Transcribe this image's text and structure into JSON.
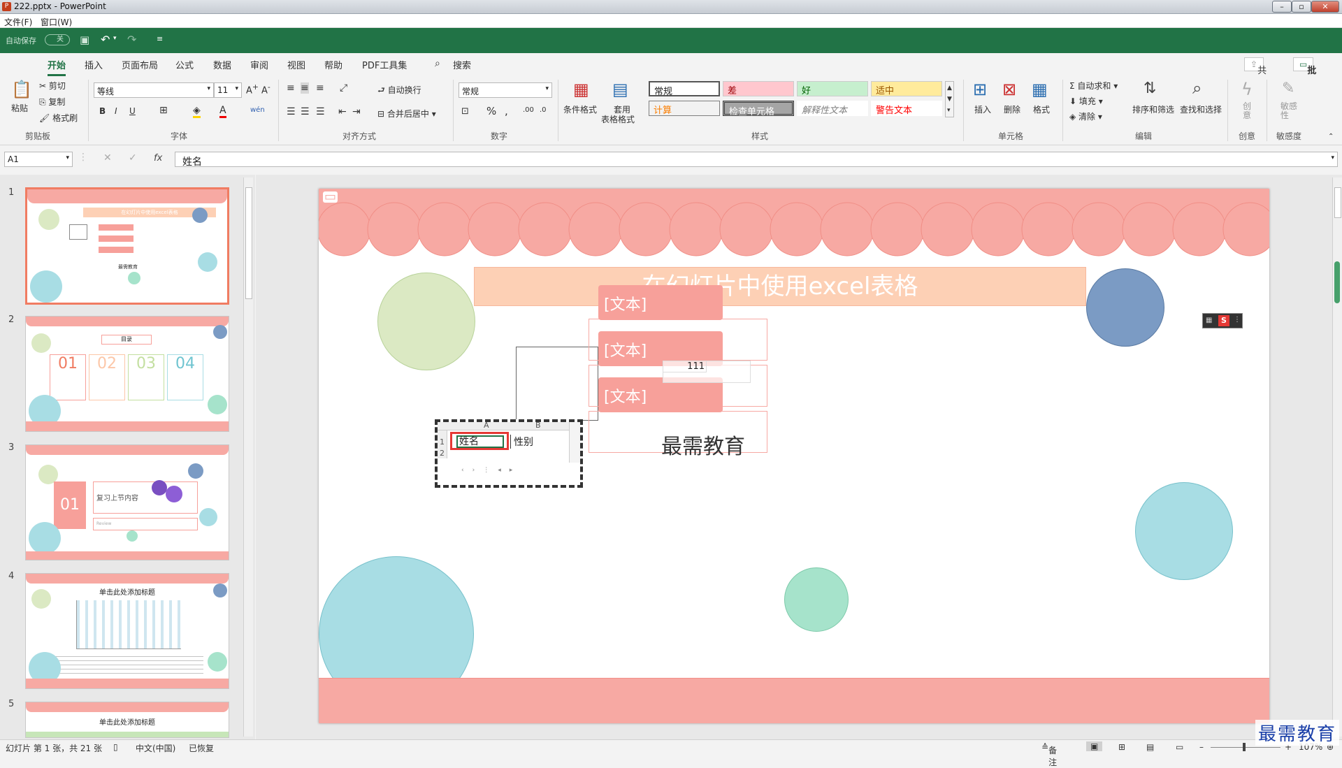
{
  "window": {
    "title": "222.pptx - PowerPoint"
  },
  "menu": {
    "file": "文件(F)",
    "window": "窗口(W)"
  },
  "qat": {
    "autosave": "自动保存",
    "toggle": "关"
  },
  "tabs": [
    "开始",
    "插入",
    "页面布局",
    "公式",
    "数据",
    "审阅",
    "视图",
    "帮助",
    "PDF工具集"
  ],
  "search": "搜索",
  "share": "共享",
  "comment": "批注",
  "ribbon": {
    "paste": "粘贴",
    "cut": "剪切",
    "copy": "复制",
    "format_painter": "格式刷",
    "clipboard": "剪贴板",
    "font_name": "等线",
    "font_size": "11",
    "font_group": "字体",
    "wrap": "自动换行",
    "merge": "合并后居中",
    "align_group": "对齐方式",
    "number_format": "常规",
    "number_group": "数字",
    "cond_format": "条件格式",
    "table_format_1": "套用",
    "table_format_2": "表格格式",
    "styles": {
      "normal": "常规",
      "bad": "差",
      "good": "好",
      "neutral": "适中",
      "calc": "计算",
      "check": "检查单元格",
      "explain": "解释性文本",
      "warn": "警告文本"
    },
    "styles_group": "样式",
    "insert": "插入",
    "delete": "删除",
    "format": "格式",
    "cells_group": "单元格",
    "autosum": "自动求和",
    "fill": "填充",
    "clear": "清除",
    "sort": "排序和筛选",
    "find": "查找和选择",
    "edit_group": "编辑",
    "create": "创意",
    "create_group": "创意",
    "sensitivity": "敏感性",
    "sensitivity_group": "敏感度"
  },
  "formula": {
    "namebox": "A1",
    "fx": "fx",
    "value": "姓名"
  },
  "thumbnails": [
    {
      "num": "1",
      "title": "在幻灯片中使用excel表格",
      "footer": "最需教育"
    },
    {
      "num": "2",
      "title": "目录",
      "items": [
        "01",
        "02",
        "03",
        "04"
      ]
    },
    {
      "num": "3",
      "badge": "01",
      "title": "复习上节内容",
      "sub": "Review"
    },
    {
      "num": "4",
      "title": "单击此处添加标题"
    },
    {
      "num": "5",
      "title": "单击此处添加标题"
    }
  ],
  "slide": {
    "title": "在幻灯片中使用excel表格",
    "boxes": [
      "[文本]",
      "[文本]",
      "[文本]"
    ],
    "subtitle": "最需教育",
    "excel": {
      "col_a": "A",
      "col_b": "B",
      "row1": "1",
      "row2": "2",
      "a1": "姓名",
      "b1": "性别"
    },
    "value_111": "111"
  },
  "status": {
    "slide_info": "幻灯片 第 1 张，共 21 张",
    "lang": "中文(中国)",
    "recovered": "已恢复",
    "notes": "备注",
    "zoom": "107%"
  },
  "watermark": "最需教育",
  "colors": {
    "accent": "#217346",
    "scallop": "#f7a9a3",
    "title_bar": "#fdd0b5",
    "text_box": "#f7a09a",
    "green_circle": "#dbe9c3",
    "blue_circle": "#7b9bc4",
    "teal_circle": "#a8dde4",
    "mint_circle": "#a6e3cb"
  }
}
